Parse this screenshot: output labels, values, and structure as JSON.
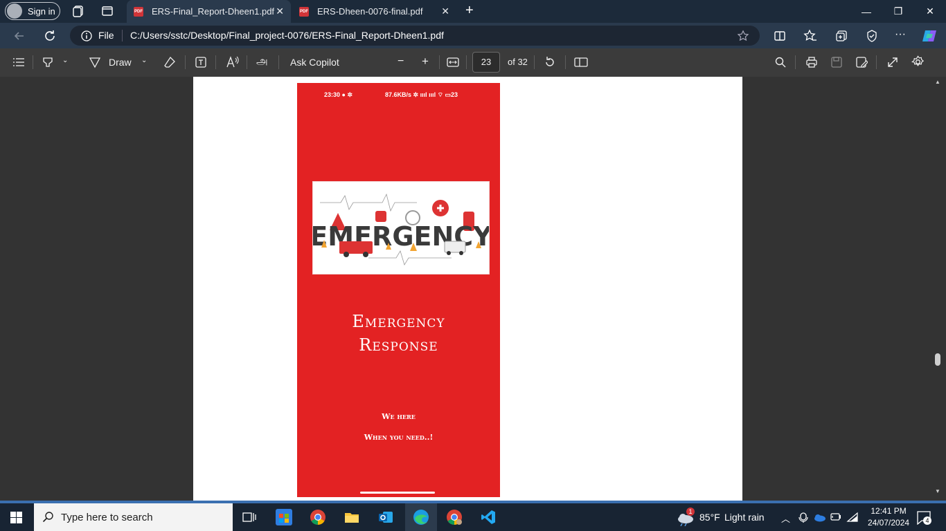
{
  "browser": {
    "signin_label": "Sign in",
    "tabs": [
      {
        "title": "ERS-Final_Report-Dheen1.pdf",
        "active": true
      },
      {
        "title": "ERS-Dheen-0076-final.pdf",
        "active": false
      }
    ],
    "new_tab_symbol": "+",
    "address": {
      "scheme_label": "File",
      "url": "C:/Users/sstc/Desktop/Final_project-0076/ERS-Final_Report-Dheen1.pdf"
    }
  },
  "pdf_toolbar": {
    "draw_label": "Draw",
    "copilot_label": "Ask Copilot",
    "page_current": "23",
    "page_total_label": "of 32",
    "translit_glyph": "அ"
  },
  "phone": {
    "status_time": "23:30",
    "status_right": "87.6KB/s",
    "battery": "23",
    "image_text": "EMERGENCY",
    "title_line1": "Emergency",
    "title_line2": "Response",
    "tagline1": "We here",
    "tagline2": "When you need..!"
  },
  "taskbar": {
    "search_placeholder": "Type here to search",
    "weather_temp": "85°F",
    "weather_desc": "Light rain",
    "weather_badge": "1",
    "time": "12:41 PM",
    "date": "24/07/2024",
    "notif_count": "4"
  },
  "colors": {
    "phone_bg": "#e32223",
    "titlebar": "#1c2a3a",
    "toolbar": "#3b3b3b"
  }
}
